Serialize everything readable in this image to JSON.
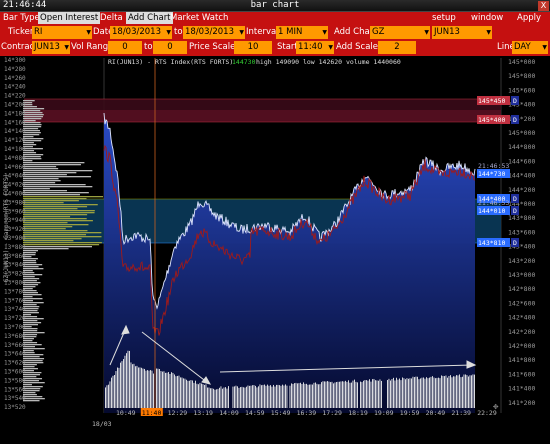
{
  "titlebar": {
    "clock": "21:46:44",
    "title": "bar chart",
    "close": "X"
  },
  "menubar": {
    "left": [
      "Bar Type",
      "Open Interest",
      "Delta",
      "Add Chart",
      "Market Watch"
    ],
    "right": [
      "setup",
      "window",
      "Apply"
    ]
  },
  "toolbar": {
    "ticker_label": "Ticker",
    "ticker_value": "RI",
    "date_label": "Date",
    "date_from": "18/03/2013",
    "date_to_label": "to",
    "date_to": "18/03/2013",
    "interval_label": "Interval",
    "interval_value": "1 MIN",
    "add_chart_label": "Add Chart",
    "add_chart_value": "GZ",
    "add_chart_contract": "JUN13",
    "contract_label": "Contract",
    "contract_value": "JUN13",
    "vol_range_label": "Vol Range",
    "vol_from": "0",
    "vol_to_label": "to",
    "vol_to": "0",
    "price_scale_label": "Price Scale",
    "price_scale_value": "10",
    "start_label": "Start",
    "start_value": "11:40",
    "add_scale_label": "Add Scale",
    "add_scale_value": "2",
    "line_label": "Line",
    "line_value": "DAY"
  },
  "chart": {
    "info": "RI(JUN13) - RTS Index(RTS FORTS)",
    "info_last": "144730",
    "info_rest": "high 149090  low 142620  volume 1440060",
    "left_axis_title": "GZ(JUN13) - Gazprom(RTS FORTS)",
    "left_ticks": [
      "14*300",
      "14*280",
      "14*260",
      "14*240",
      "14*220",
      "14*200",
      "14*180",
      "14*160",
      "14*140",
      "14*120",
      "14*100",
      "14*080",
      "14*060",
      "14*040",
      "14*020",
      "14*000",
      "13*980",
      "13*960",
      "13*940",
      "13*920",
      "13*900",
      "13*880",
      "13*860",
      "13*840",
      "13*820",
      "13*800",
      "13*780",
      "13*760",
      "13*740",
      "13*720",
      "13*700",
      "13*680",
      "13*660",
      "13*640",
      "13*620",
      "13*600",
      "13*580",
      "13*560",
      "13*540",
      "13*520"
    ],
    "right_ticks": [
      "145*000",
      "145*800",
      "145*600",
      "145*400",
      "145*200",
      "145*000",
      "144*800",
      "144*600",
      "144*400",
      "144*200",
      "144*000",
      "143*800",
      "143*600",
      "143*400",
      "143*200",
      "143*000",
      "142*800",
      "142*600",
      "142*400",
      "142*200",
      "142*000",
      "141*800",
      "141*600",
      "141*400",
      "141*200"
    ],
    "time_ticks": [
      "10:49",
      "11:40",
      "12:29",
      "13:19",
      "14:09",
      "14:59",
      "15:49",
      "16:39",
      "17:29",
      "18:19",
      "19:09",
      "19:59",
      "20:49",
      "21:39",
      "22:29"
    ],
    "date_label": "18/03",
    "price_tags": [
      {
        "text": "145*450",
        "flag": "D",
        "color": "#c03040"
      },
      {
        "text": "145*400",
        "flag": "D",
        "color": "#c03040"
      },
      {
        "text": "21:46:53",
        "flag": "",
        "color": "#3050c0"
      },
      {
        "text": "144*730",
        "flag": "",
        "color": "#2a6cff"
      },
      {
        "text": "144*400",
        "flag": "D",
        "color": "#2a6cff"
      },
      {
        "text": "21:46:53",
        "flag": "",
        "color": "#3050c0"
      },
      {
        "text": "144*010",
        "flag": "D",
        "color": "#2a6cff"
      },
      {
        "text": "143*810",
        "flag": "D",
        "color": "#2a6cff"
      }
    ]
  },
  "colors": {
    "bar": "#c51010",
    "input": "#ff9900",
    "price_fill": "#2a4cc8",
    "second_line": "#a01a1a"
  }
}
